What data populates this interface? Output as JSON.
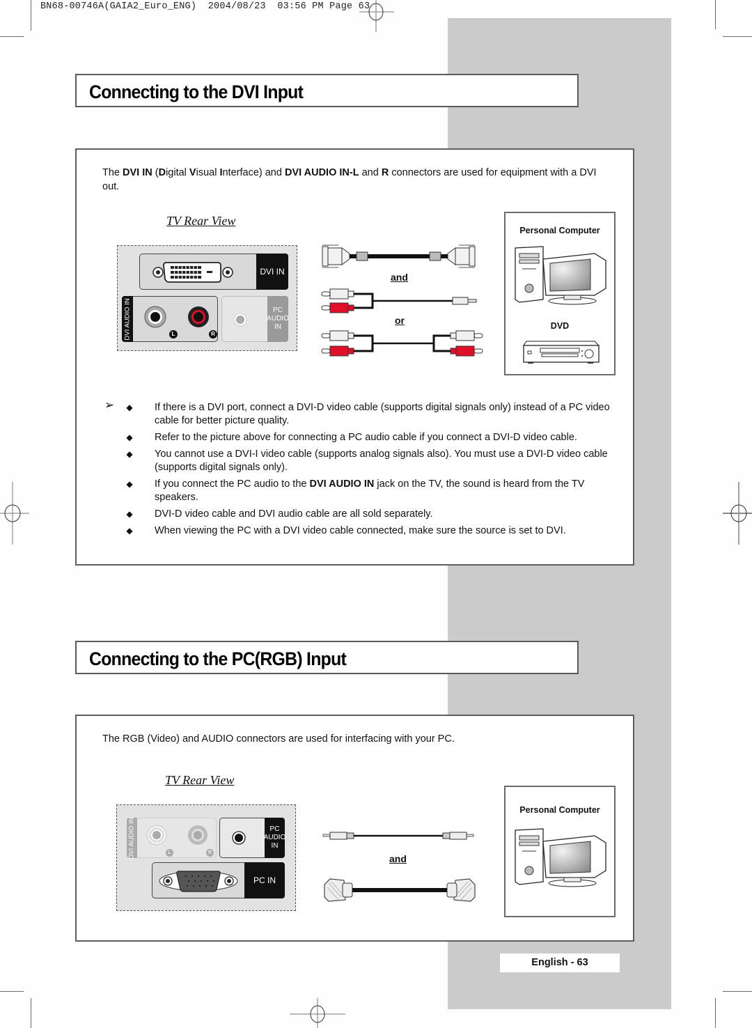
{
  "print_header": {
    "doc_id": "BN68-00746A(GAIA2_Euro_ENG)",
    "date": "2004/08/23",
    "time": "03:56 PM",
    "page_label": "Page",
    "page_no": "63"
  },
  "section_dvi": {
    "title": "Connecting to the DVI Input",
    "intro": {
      "p1": "The ",
      "b1": "DVI IN",
      "p2": " (",
      "b2": "D",
      "p3": "igital ",
      "b3": "V",
      "p4": "isual ",
      "b4": "I",
      "p5": "nterface) and ",
      "b5": "DVI AUDIO IN-L",
      "p6": " and ",
      "b6": "R",
      "p7": " connectors are used for equipment with a DVI out."
    },
    "rear_view_title": "TV Rear View",
    "rear_panel": {
      "dvi_in_label": "DVI IN",
      "dvi_audio_in_label": "DVI AUDIO IN",
      "left_label": "L",
      "right_label": "R",
      "pc_audio_in_label": "PC\nAUDIO\nIN"
    },
    "cables": {
      "and_label": "and",
      "or_label": "or"
    },
    "devices": {
      "pc_label": "Personal Computer",
      "dvd_label": "DVD"
    },
    "notes_arrow": "➢",
    "bullet": "◆",
    "notes": [
      {
        "text": "If there is a DVI port, connect a DVI-D video cable (supports digital signals only) instead of a PC video cable for better picture quality."
      },
      {
        "text": "Refer to the picture above for connecting a PC audio cable if you connect a DVI-D video cable."
      },
      {
        "text": "You cannot use a DVI-I video cable (supports analog signals also). You must use a DVI-D video cable (supports digital signals only)."
      },
      {
        "pre": "If you connect the PC audio to the ",
        "bold": "DVI AUDIO IN",
        "post": " jack on the TV, the sound is heard from the TV speakers."
      },
      {
        "text": "DVI-D video cable and  DVI audio cable are all sold separately."
      },
      {
        "text": "When viewing the PC with a DVI video cable connected, make sure the source is set to DVI."
      }
    ]
  },
  "section_pc": {
    "title": "Connecting to the PC(RGB) Input",
    "intro": "The RGB (Video) and AUDIO connectors are used for interfacing with your PC.",
    "rear_view_title": "TV Rear View",
    "rear_panel": {
      "dvi_audio_in_label": "DVI AUDIO IN",
      "left_label": "L",
      "right_label": "R",
      "pc_audio_in_label": "PC\nAUDIO\nIN",
      "pc_in_label": "PC IN"
    },
    "cables": {
      "and_label": "and"
    },
    "devices": {
      "pc_label": "Personal Computer"
    }
  },
  "footer": {
    "page_label": "English - 63"
  },
  "colors": {
    "gray_column": "#cbcbcb",
    "border": "#5e5e5e",
    "rca_red": "#e0102a",
    "panel_bg": "#e2e2e2"
  }
}
